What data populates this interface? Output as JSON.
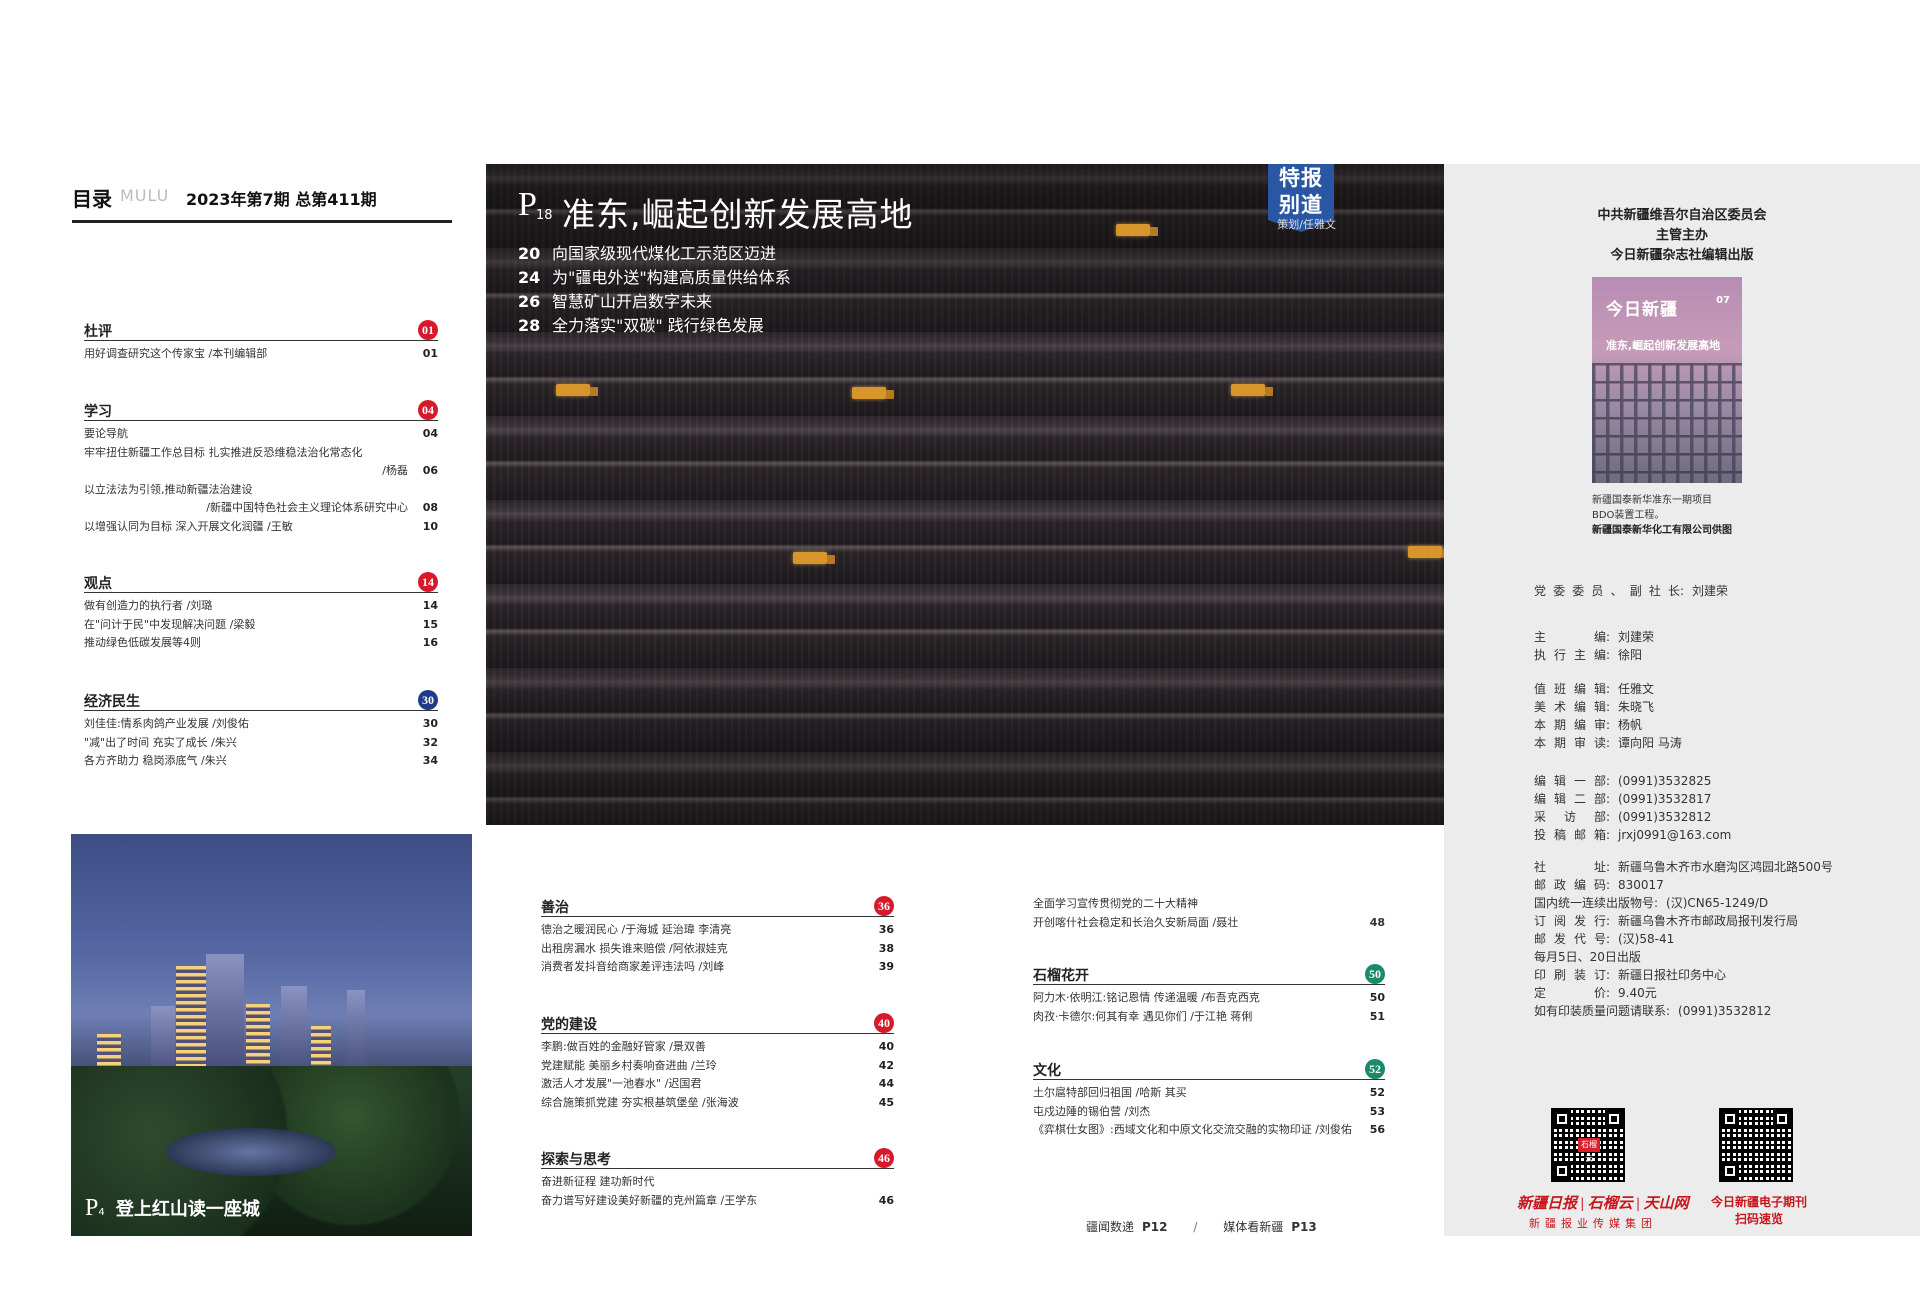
{
  "header": {
    "mulu_cn": "目录",
    "mulu_en": "MULU",
    "issue": "2023年第7期   总第411期"
  },
  "colors": {
    "red_badge": "#d71a2b",
    "navy_badge": "#1f3a8a",
    "green_badge": "#1a8a6a",
    "special_blue": "#2957a4"
  },
  "left_sections": [
    {
      "title": "杜评",
      "badge": "01",
      "badge_color": "#d71a2b",
      "items": [
        {
          "text": "用好调查研究这个传家宝 /本刊编辑部",
          "page": "01"
        }
      ]
    },
    {
      "title": "学习",
      "badge": "04",
      "badge_color": "#d71a2b",
      "items": [
        {
          "text": "要论导航",
          "page": "04"
        },
        {
          "text": "牢牢扭住新疆工作总目标   扎实推进反恐维稳法治化常态化",
          "text2": "/杨磊",
          "page": "06"
        },
        {
          "text": "以立法法为引领,推动新疆法治建设",
          "text2": "/新疆中国特色社会主义理论体系研究中心",
          "page": "08"
        },
        {
          "text": "以增强认同为目标   深入开展文化润疆 /王敏",
          "page": "10"
        }
      ]
    },
    {
      "title": "观点",
      "badge": "14",
      "badge_color": "#d71a2b",
      "items": [
        {
          "text": "做有创造力的执行者 /刘璐",
          "page": "14"
        },
        {
          "text": "在\"问计于民\"中发现解决问题 /梁毅",
          "page": "15"
        },
        {
          "text": "推动绿色低碳发展等4则",
          "page": "16"
        }
      ]
    },
    {
      "title": "经济民生",
      "badge": "30",
      "badge_color": "#1f3a8a",
      "items": [
        {
          "text": "刘佳佳:情系肉鸽产业发展 /刘俊佑",
          "page": "30"
        },
        {
          "text": "\"减\"出了时间   充实了成长 /朱兴",
          "page": "32"
        },
        {
          "text": "各方齐助力   稳岗添底气 /朱兴",
          "page": "34"
        }
      ]
    }
  ],
  "feature": {
    "page_p": "P",
    "page_num": "18",
    "title": "准东,崛起创新发展高地",
    "items": [
      {
        "num": "20",
        "text": "向国家级现代煤化工示范区迈进"
      },
      {
        "num": "24",
        "text": "为\"疆电外送\"构建高质量供给体系"
      },
      {
        "num": "26",
        "text": "智慧矿山开启数字未来"
      },
      {
        "num": "28",
        "text": "全力落实\"双碳\"   践行绿色发展"
      }
    ],
    "badge_line1": "特报",
    "badge_line2": "别道",
    "credit": "策划/任雅文"
  },
  "city_photo": {
    "page_p": "P",
    "page_num": "4",
    "caption": "登上红山读一座城"
  },
  "mid_sections": [
    {
      "title": "善治",
      "badge": "36",
      "badge_color": "#d71a2b",
      "items": [
        {
          "text": "德治之暖润民心 /于海城   延治瑋   李清亮",
          "page": "36"
        },
        {
          "text": "出租房漏水   损失谁来赔偿 /阿依淑娃克",
          "page": "38"
        },
        {
          "text": "消费者发抖音给商家差评违法吗 /刘峰",
          "page": "39"
        }
      ]
    },
    {
      "title": "党的建设",
      "badge": "40",
      "badge_color": "#d71a2b",
      "items": [
        {
          "text": "李鹏:做百姓的金融好管家 /景双善",
          "page": "40"
        },
        {
          "text": "党建赋能   美丽乡村奏响奋进曲 /兰玲",
          "page": "42"
        },
        {
          "text": "激活人才发展\"一池春水\" /迟国君",
          "page": "44"
        },
        {
          "text": "综合施策抓党建   夯实根基筑堡垒 /张海波",
          "page": "45"
        }
      ]
    },
    {
      "title": "探索与思考",
      "badge": "46",
      "badge_color": "#d71a2b",
      "items": [
        {
          "text": "奋进新征程   建功新时代",
          "page": ""
        },
        {
          "text": "奋力谱写好建设美好新疆的克州篇章 /王学东",
          "page": "46"
        }
      ]
    }
  ],
  "mid_right": {
    "top_items": [
      {
        "text": "全面学习宣传贯彻党的二十大精神",
        "page": ""
      },
      {
        "text": "开创喀什社会稳定和长治久安新局面 /聂壮",
        "page": "48"
      }
    ],
    "sections": [
      {
        "title": "石榴花开",
        "badge": "50",
        "badge_color": "#1a8a6a",
        "items": [
          {
            "text": "阿力木·依明江:铭记恩情   传递温暖 /布吾克西克",
            "page": "50"
          },
          {
            "text": "肉孜·卡德尔:何其有幸   遇见你们 /于江艳   蒋俐",
            "page": "51"
          }
        ]
      },
      {
        "title": "文化",
        "badge": "52",
        "badge_color": "#1a8a6a",
        "items": [
          {
            "text": "土尔扈特部回归祖国 /哈斯   其买",
            "page": "52"
          },
          {
            "text": "屯戍边陲的锡伯营 /刘杰",
            "page": "53"
          },
          {
            "text": "《弈棋仕女图》:西域文化和中原文化交流交融的实物印证 /刘俊佑",
            "page": "56"
          }
        ]
      }
    ]
  },
  "footer": {
    "link1": "疆闻数递",
    "link1_page": "P12",
    "sep": "/",
    "link2": "媒体看新疆",
    "link2_page": "P13"
  },
  "right_panel": {
    "publisher": [
      "中共新疆维吾尔自治区委员会",
      "主管主办",
      "今日新疆杂志社编辑出版"
    ],
    "cover": {
      "logo": "今日新疆",
      "issue": "07",
      "title": "准东,崛起创新发展高地"
    },
    "cover_caption": [
      "新疆国泰新华准东一期项目",
      "BDO装置工程。"
    ],
    "cover_credit": "新疆国泰新华化工有限公司供图",
    "staff_top": {
      "label": "党委委员、副社长",
      "value": "刘建荣"
    },
    "staff": [
      {
        "label": "主编",
        "value": "刘建荣"
      },
      {
        "label": "执行主编",
        "value": "徐阳"
      },
      {
        "label": "值班编辑",
        "value": "任雅文"
      },
      {
        "label": "美术编辑",
        "value": "朱晓飞"
      },
      {
        "label": "本期编审",
        "value": "杨帆"
      },
      {
        "label": "本期审读",
        "value": "谭向阳   马涛"
      },
      {
        "label": "编辑一部",
        "value": "(0991)3532825"
      },
      {
        "label": "编辑二部",
        "value": "(0991)3532817"
      },
      {
        "label": "采访部",
        "value": "(0991)3532812"
      },
      {
        "label": "投稿邮箱",
        "value": "jrxj0991@163.com"
      },
      {
        "label": "社址",
        "value": "新疆乌鲁木齐市水磨沟区鸿园北路500号"
      },
      {
        "label": "邮政编码",
        "value": "830017"
      },
      {
        "label": "国内统一连续出版物号",
        "value": "(汉)CN65-1249/D"
      },
      {
        "label": "订阅发行",
        "value": "新疆乌鲁木齐市邮政局报刊发行局"
      },
      {
        "label": "邮发代号",
        "value": "(汉)58-41"
      },
      {
        "label": "",
        "value": "每月5日、20日出版"
      },
      {
        "label": "印刷装订",
        "value": "新疆日报社印务中心"
      },
      {
        "label": "定价",
        "value": "9.40元"
      },
      {
        "label": "如有印装质量问题请联系",
        "value": "(0991)3532812"
      }
    ],
    "group_logo_script": "新疆日报 | 石榴云 | 天山网",
    "group_name": "新疆报业传媒集团",
    "ejournal": [
      "今日新疆电子期刊",
      "扫码速览"
    ],
    "qr_logo": "石榴云"
  }
}
